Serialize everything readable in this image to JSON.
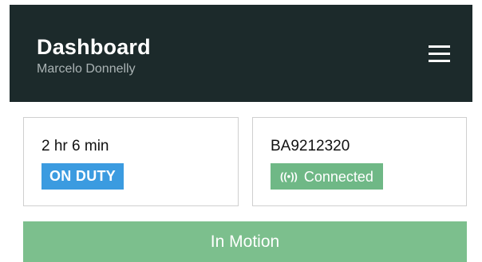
{
  "header": {
    "title": "Dashboard",
    "subtitle": "Marcelo Donnelly",
    "menu_icon": "hamburger-menu-icon",
    "background_color": "#1c2a2b"
  },
  "duty_card": {
    "time": "2 hr 6 min",
    "status": "ON DUTY",
    "status_color": "#3b9be0"
  },
  "device_card": {
    "device_id": "BA9212320",
    "connection_icon": "broadcast-signal-icon",
    "connection_glyph": "((•))",
    "connection_status": "Connected",
    "connection_color": "#6fb886"
  },
  "motion_bar": {
    "label": "In Motion",
    "color": "#7cbf8d"
  }
}
